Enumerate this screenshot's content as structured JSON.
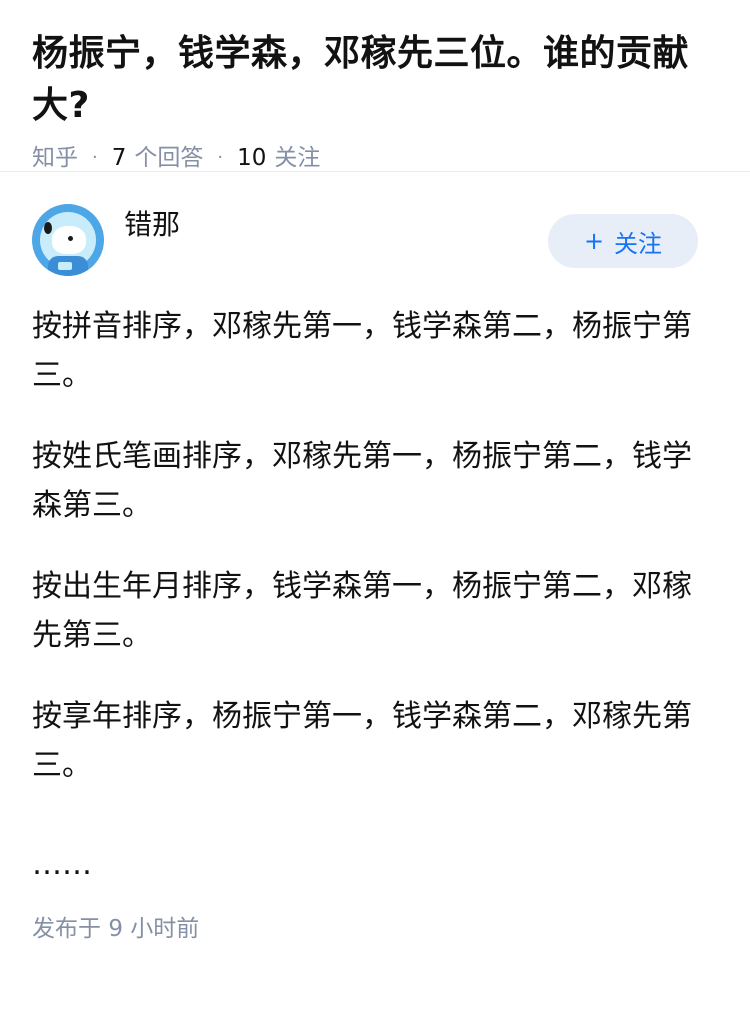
{
  "question": {
    "title": "杨振宁，钱学森，邓稼先三位。谁的贡献大?",
    "source": "知乎",
    "answer_count": "7",
    "answer_label": "个回答",
    "follower_count": "10",
    "follower_label": "关注"
  },
  "answer": {
    "author": {
      "name": "错那",
      "avatar_icon": "astronaut-bear-avatar"
    },
    "follow_button": {
      "icon": "+",
      "label": "关注"
    },
    "paragraphs": [
      "按拼音排序，邓稼先第一，钱学森第二，杨振宁第三。",
      "按姓氏笔画排序，邓稼先第一，杨振宁第二，钱学森第三。",
      "按出生年月排序，钱学森第一，杨振宁第二，邓稼先第三。",
      "按享年排序，杨振宁第一，钱学森第二，邓稼先第三。"
    ],
    "ellipsis": "……",
    "publish_label": "发布于",
    "publish_time": "9 小时前"
  },
  "colors": {
    "meta_gray": "#8590a6",
    "follow_blue": "#1772f6",
    "follow_bg": "#e7eef8"
  }
}
